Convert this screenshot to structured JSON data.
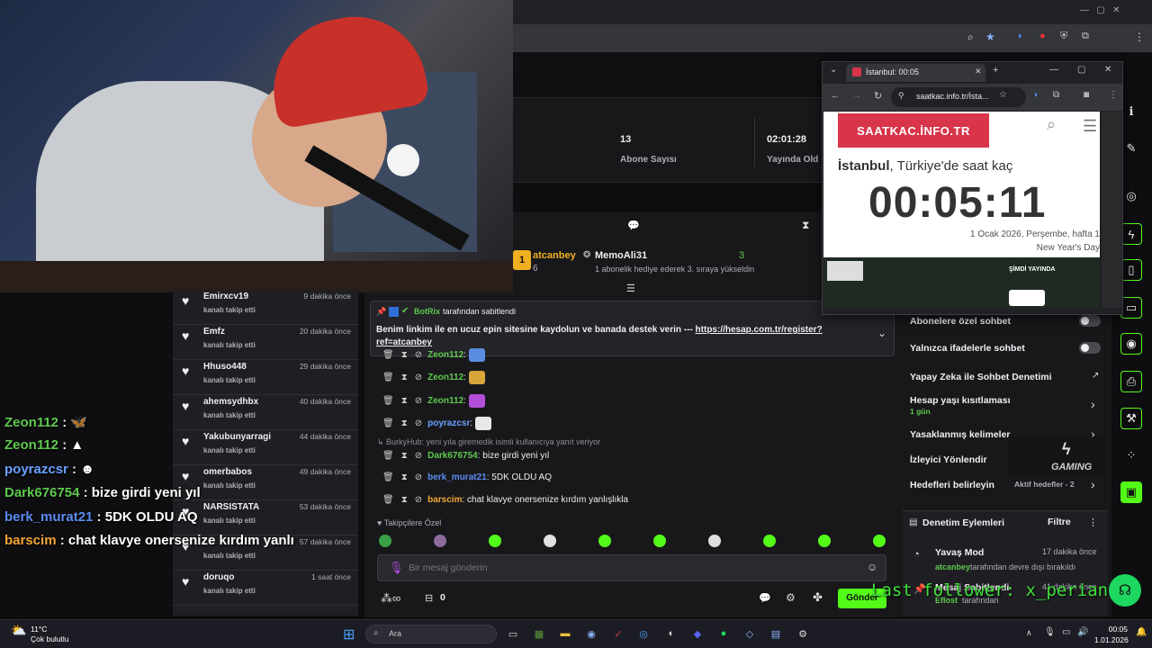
{
  "browser": {
    "tab_label": "",
    "window_controls": [
      "—",
      "▢",
      "✕"
    ]
  },
  "stats": {
    "subs_value": "13",
    "subs_label": "Abone Sayısı",
    "time_value": "02:01:28",
    "time_label": "Yayında Old"
  },
  "leftchat": [
    {
      "user": "Zeon112",
      "sep": " : ",
      "text": "🦋",
      "color": "#5ec94e"
    },
    {
      "user": "Zeon112",
      "sep": " : ",
      "text": "▲",
      "color": "#5ec94e"
    },
    {
      "user": "poyrazcsr",
      "sep": " : ",
      "text": "☻",
      "color": "#6aa0ff"
    },
    {
      "user": "Dark676754",
      "sep": " : ",
      "text": "bize girdi yeni yıl",
      "color": "#5ec94e"
    },
    {
      "user": "berk_murat21",
      "sep": " : ",
      "text": "5DK OLDU AQ",
      "color": "#5b8def"
    },
    {
      "user": "barscim",
      "sep": " : ",
      "text": "chat klavye onersenize kırdım yanlı",
      "color": "#f3a634"
    }
  ],
  "followers": [
    {
      "name": "Emirxcv19",
      "sub": "kanalı takip etti",
      "time": "9 dakika önce"
    },
    {
      "name": "Emfz",
      "sub": "kanalı takip etti",
      "time": "20 dakika önce"
    },
    {
      "name": "Hhuso448",
      "sub": "kanalı takip etti",
      "time": "29 dakika önce"
    },
    {
      "name": "ahemsydhbx",
      "sub": "kanalı takip etti",
      "time": "40 dakika önce"
    },
    {
      "name": "Yakubunyarragi",
      "sub": "kanalı takip etti",
      "time": "44 dakika önce"
    },
    {
      "name": "omerbabos",
      "sub": "kanalı takip etti",
      "time": "49 dakika önce"
    },
    {
      "name": "NARSISTATA",
      "sub": "kanalı takip etti",
      "time": "53 dakika önce"
    },
    {
      "name": "",
      "sub": "kanalı takip etti",
      "time": "57 dakika önce"
    },
    {
      "name": "doruqo",
      "sub": "kanalı takip etti",
      "time": "1 saat önce"
    }
  ],
  "gift": {
    "user1": "atcanbey",
    "count1": "6",
    "user2": "MemoAli31",
    "count2": "3",
    "text": "1 abonelik hediye ederek 3. sıraya yükseldin"
  },
  "pinned": {
    "by_user": "BotRix",
    "by_text": "tarafından sabitlendi",
    "msg": "Benim linkim ile en ucuz epin sitesine kaydolun ve banada destek verin --- ",
    "link": "https://hesap.com.tr/register?ref=atcanbey"
  },
  "chat": [
    {
      "user": "Zeon112",
      "sep": ": ",
      "text": "",
      "color": "#5ec94e"
    },
    {
      "user": "Zeon112",
      "sep": ": ",
      "text": "",
      "color": "#5ec94e"
    },
    {
      "user": "Zeon112",
      "sep": ": ",
      "text": "",
      "color": "#5ec94e"
    },
    {
      "user": "poyrazcsr",
      "sep": ": ",
      "text": "",
      "color": "#6aa0ff"
    },
    {
      "user": "Dark676754",
      "sep": ": ",
      "text": "bize girdi yeni yıl",
      "color": "#5ec94e"
    },
    {
      "user": "berk_murat21",
      "sep": ": ",
      "text": "5DK OLDU AQ",
      "color": "#5b8def"
    },
    {
      "user": "barscim",
      "sep": ": ",
      "text": "chat klavye onersenize kırdım yanlışlıkla",
      "color": "#f3a634"
    }
  ],
  "reply_note": "BurkyHub: yeni yıla giremedik isimli kullanıcıya yanıt veriyor",
  "followers_only": "Takipçilere Özel",
  "input": {
    "placeholder": "Bir mesaj gönderin"
  },
  "bottom": {
    "points": "0",
    "send": "Gönder"
  },
  "popup": {
    "tab_title": "İstanbul: 00:05",
    "url": "saatkac.info.tr/İsta...",
    "logo": "SAATKAC.İNFO.TR",
    "city": "İstanbul",
    "city_rest": ", Türkiye'de saat kaç",
    "clock": "00:05:11",
    "date": "1 Ocak 2026, Perşembe, hafta 1",
    "holiday": "New Year's Day",
    "ad_now": "ŞİMDİ YAYINDA"
  },
  "settings": [
    {
      "label": "Abonelere özel sohbet"
    },
    {
      "label": "Yalnızca ifadelerle sohbet"
    },
    {
      "label": "Yapay Zeka ile Sohbet Denetimi"
    },
    {
      "label": "Hesap yaşı kısıtlaması",
      "sub": "1 gün"
    },
    {
      "label": "Yasaklanmış kelimeler"
    },
    {
      "label": "İzleyici Yönlendir"
    },
    {
      "label": "Hedefleri belirleyin",
      "sub": "Aktif hedefler - 2"
    }
  ],
  "mod": {
    "title": "Denetim Eylemleri",
    "filter": "Filtre",
    "a1_title": "Yavaş Mod",
    "a1_time": "17 dakika önce",
    "a1_user": "atcanbey",
    "a1_text": "tarafından devre dışı bırakıldı",
    "a2_title": "Mesaj Sabitlendi",
    "a2_time": "41 dakika önce",
    "a2_user": "Eflost",
    "a2_text": "tarafından"
  },
  "overlay": {
    "last_follower": "Last follower: x_perian",
    "gaming": "GAMING"
  },
  "taskbar": {
    "temp": "11°C",
    "weather": "Çok bulutlu",
    "search": "Ara",
    "time": "00:05",
    "date": "1.01.2026"
  }
}
